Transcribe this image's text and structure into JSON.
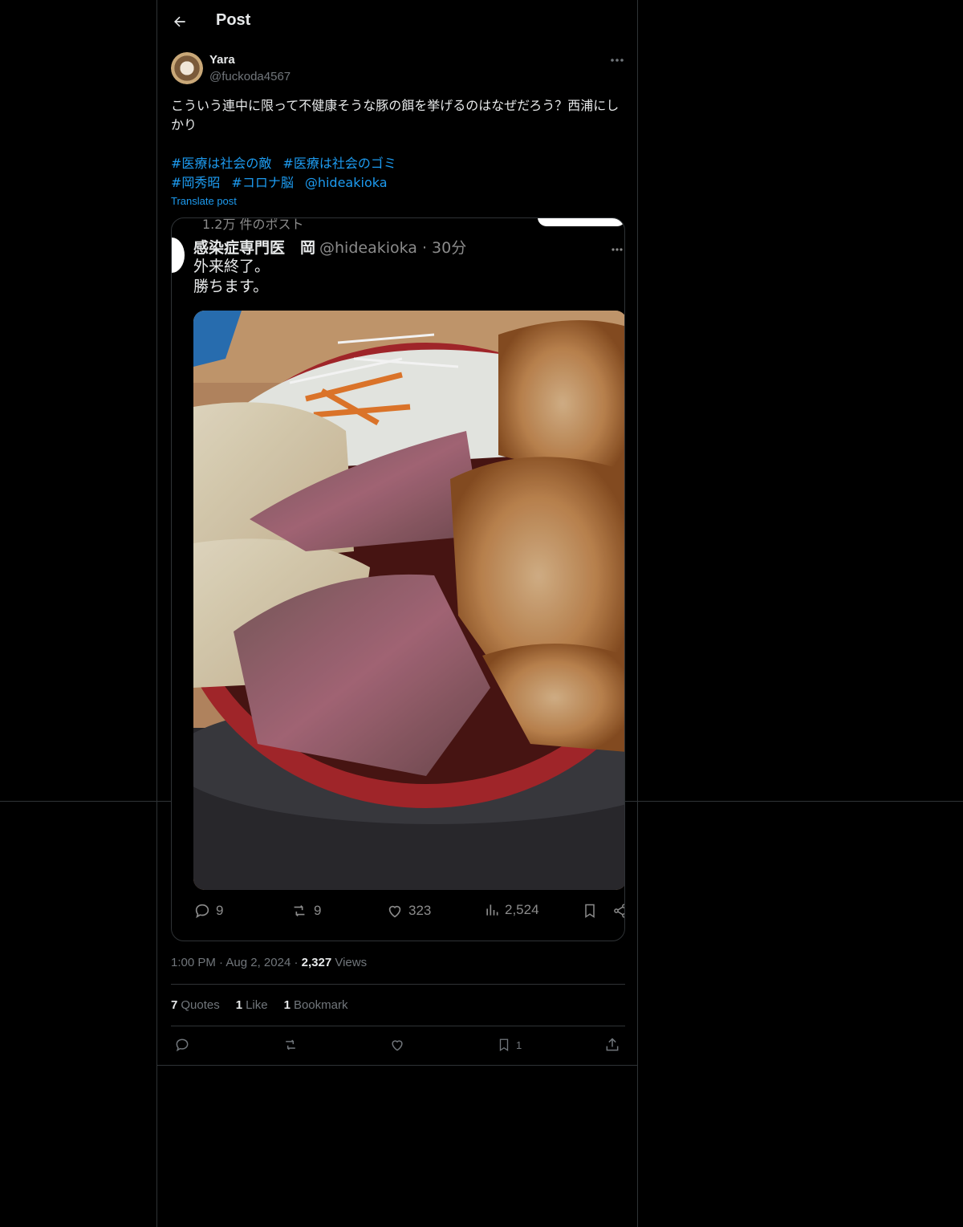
{
  "header": {
    "title": "Post"
  },
  "post": {
    "author_name": "Yara",
    "author_handle": "@fuckoda4567",
    "text": "こういう連中に限って不健康そうな豚の餌を挙げるのはなぜだろう？西浦にしかり",
    "tags": [
      "#医療は社会の敵",
      "#医療は社会のゴミ",
      "#岡秀昭",
      "#コロナ脳",
      "@hideakioka"
    ],
    "translate_label": "Translate post",
    "timestamp_time": "1:00 PM",
    "timestamp_date": "Aug 2, 2024",
    "views_count": "2,327",
    "views_label": "Views"
  },
  "embedded_screenshot": {
    "top_label": "1.2万 件のポスト",
    "name": "感染症専門医　岡",
    "handle_time": "@hideakioka · 30分",
    "text_line1": "外来終了。",
    "text_line2": "勝ちます。",
    "replies": "9",
    "reposts": "9",
    "likes": "323",
    "views": "2,524"
  },
  "stats": {
    "quotes_count": "7",
    "quotes_label": "Quotes",
    "likes_count": "1",
    "likes_label": "Like",
    "bookmarks_count": "1",
    "bookmarks_label": "Bookmark"
  },
  "actions": {
    "bookmark_count": "1"
  }
}
